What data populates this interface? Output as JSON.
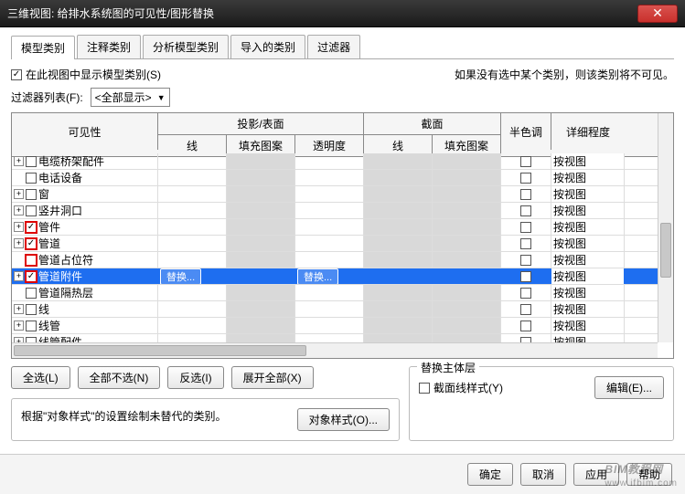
{
  "titlebar": {
    "title": "三维视图: 给排水系统图的可见性/图形替换"
  },
  "tabs": [
    {
      "label": "模型类别",
      "active": true
    },
    {
      "label": "注释类别"
    },
    {
      "label": "分析模型类别"
    },
    {
      "label": "导入的类别"
    },
    {
      "label": "过滤器"
    }
  ],
  "options": {
    "show_in_view": "在此视图中显示模型类别(S)",
    "hint": "如果没有选中某个类别，则该类别将不可见。",
    "filter_label": "过滤器列表(F):",
    "filter_value": "<全部显示>"
  },
  "headers": {
    "visibility": "可见性",
    "projection": "投影/表面",
    "section": "截面",
    "line": "线",
    "fill": "填充图案",
    "trans": "透明度",
    "half": "半色调",
    "detail": "详细程度"
  },
  "rows": [
    {
      "name": "电缆桥架配件",
      "checked": false,
      "exp": true
    },
    {
      "name": "电话设备",
      "checked": false
    },
    {
      "name": "窗",
      "checked": false,
      "exp": true
    },
    {
      "name": "竖井洞口",
      "checked": false,
      "exp": true
    },
    {
      "name": "管件",
      "checked": true,
      "exp": true,
      "hl": true
    },
    {
      "name": "管道",
      "checked": true,
      "exp": true,
      "hl": true
    },
    {
      "name": "管道占位符",
      "checked": false,
      "hl": true
    },
    {
      "name": "管道附件",
      "checked": true,
      "exp": true,
      "hl": true,
      "selected": true,
      "override": "替换..."
    },
    {
      "name": "管道隔热层",
      "checked": false
    },
    {
      "name": "线",
      "checked": false,
      "exp": true
    },
    {
      "name": "线管",
      "checked": false,
      "exp": true
    },
    {
      "name": "线管配件",
      "checked": false,
      "exp": true
    }
  ],
  "detail_default": "按视图",
  "buttons": {
    "all": "全选(L)",
    "none": "全部不选(N)",
    "invert": "反选(I)",
    "expand": "展开全部(X)",
    "obj_style": "对象样式(O)...",
    "edit": "编辑(E)..."
  },
  "desc": "根据\"对象样式\"的设置绘制未替代的类别。",
  "override_group": {
    "legend": "替换主体层",
    "section_style": "截面线样式(Y)"
  },
  "footer": {
    "ok": "确定",
    "cancel": "取消",
    "apply": "应用",
    "help": "帮助"
  },
  "watermark": {
    "main": "BIM教程网",
    "sub": "www.ifbim.com"
  }
}
